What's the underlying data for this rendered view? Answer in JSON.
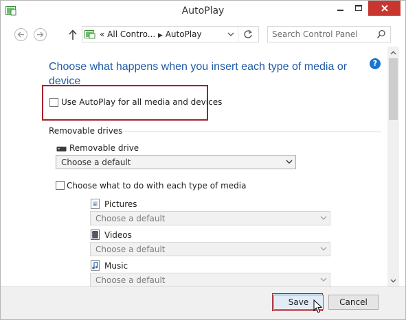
{
  "window": {
    "title": "AutoPlay"
  },
  "address": {
    "path_prefix": "«",
    "path_items": [
      "All Contro...",
      "AutoPlay"
    ],
    "search_placeholder": "Search Control Panel"
  },
  "content": {
    "heading": "Choose what happens when you insert each type of media or device",
    "help_glyph": "?",
    "use_autoplay_label": "Use AutoPlay for all media and devices",
    "use_autoplay_checked": false,
    "section_removable": "Removable drives",
    "removable_drive": {
      "label": "Removable drive",
      "value": "Choose a default"
    },
    "each_media_label": "Choose what to do with each type of media",
    "each_media_checked": false,
    "media": [
      {
        "label": "Pictures",
        "value": "Choose a default",
        "icon": "pictures-icon"
      },
      {
        "label": "Videos",
        "value": "Choose a default",
        "icon": "videos-icon"
      },
      {
        "label": "Music",
        "value": "Choose a default",
        "icon": "music-icon"
      }
    ]
  },
  "footer": {
    "save_label": "Save",
    "cancel_label": "Cancel"
  },
  "colors": {
    "heading": "#1e5aa8",
    "highlight": "#a51f2a",
    "close_button": "#c7372f",
    "help_icon": "#1c74d0"
  }
}
